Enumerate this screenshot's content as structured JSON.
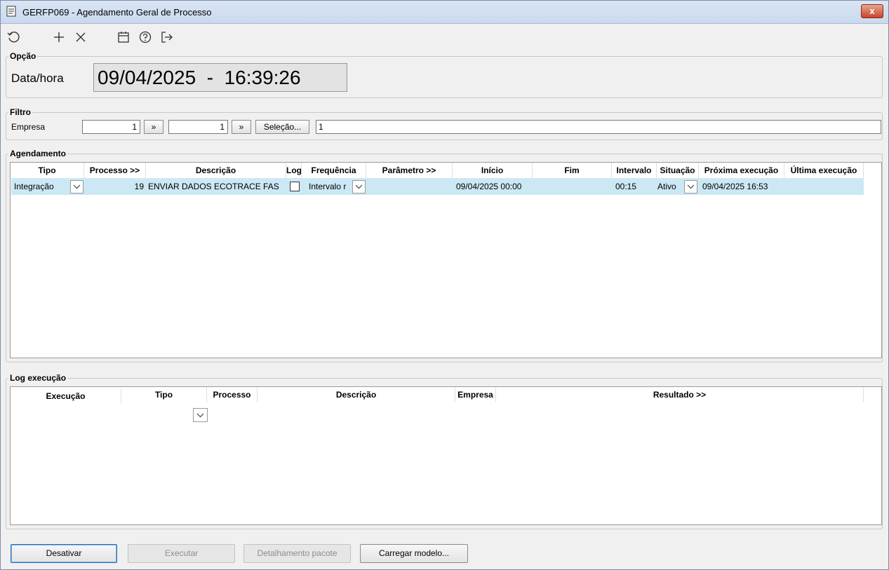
{
  "window": {
    "title": "GERFP069 - Agendamento Geral de Processo",
    "close_label": "x"
  },
  "toolbar": {
    "icons": [
      "refresh-icon",
      "add-icon",
      "delete-icon",
      "calendar-icon",
      "help-icon",
      "exit-icon"
    ]
  },
  "opcao": {
    "legend": "Opção",
    "datahora_label": "Data/hora",
    "datahora_value": "09/04/2025  -  16:39:26"
  },
  "filtro": {
    "legend": "Filtro",
    "empresa_label": "Empresa",
    "empresa_from": "1",
    "empresa_to": "1",
    "jump_label": "»",
    "selecao_label": "Seleção...",
    "selecao_value": "1"
  },
  "agendamento": {
    "legend": "Agendamento",
    "headers": [
      "Tipo",
      "Processo >>",
      "Descrição",
      "Log",
      "Frequência",
      "Parâmetro >>",
      "Início",
      "Fim",
      "Intervalo",
      "Situação",
      "Próxima execução",
      "Última execução"
    ],
    "row": {
      "tipo": "Integração",
      "processo": "19",
      "descricao": "ENVIAR DADOS ECOTRACE FAS",
      "log_checked": false,
      "frequencia": "Intervalo r",
      "parametro": "",
      "inicio": "09/04/2025 00:00",
      "fim": "",
      "intervalo": "00:15",
      "situacao": "Ativo",
      "proxima": "09/04/2025 16:53",
      "ultima": ""
    }
  },
  "log": {
    "legend": "Log execução",
    "headers": [
      "Execução",
      "Tipo",
      "Processo",
      "Descrição",
      "Empresa",
      "Resultado >>"
    ]
  },
  "buttons": {
    "desativar": "Desativar",
    "executar": "Executar",
    "detalhamento": "Detalhamento pacote",
    "carregar": "Carregar modelo..."
  },
  "colors": {
    "selected_row": "#cce8f4",
    "default_button_border": "#2b6fb6"
  }
}
